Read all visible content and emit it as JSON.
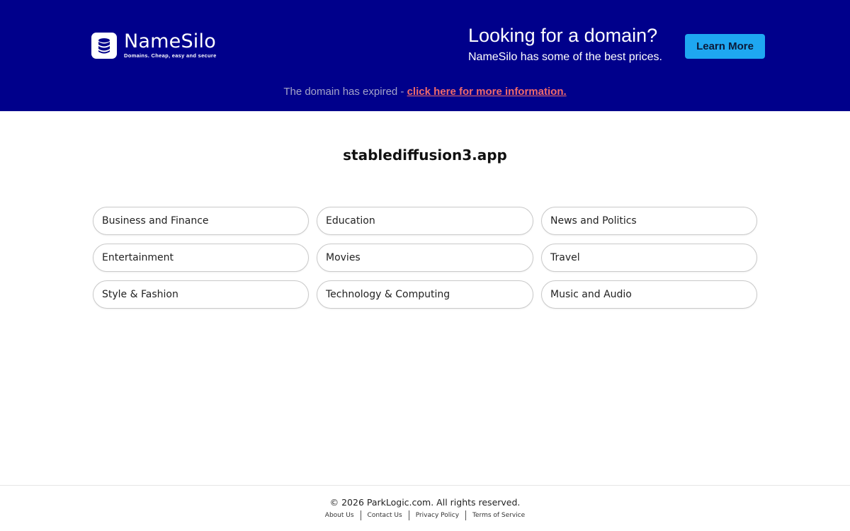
{
  "banner": {
    "logo": {
      "name": "NameSilo",
      "tagline": "Domains. Cheap, easy and secure",
      "icon": "database-icon"
    },
    "promo_title": "Looking for a domain?",
    "promo_subtitle": "NameSilo has some of the best prices.",
    "learn_more_label": "Learn More",
    "expired_text": "The domain has expired - ",
    "expired_link": "click here for more information.",
    "colors": {
      "background": "#00008b",
      "button": "#1ea7f1",
      "link": "#f06a6a"
    }
  },
  "main": {
    "domain": "stablediffusion3.app",
    "categories": [
      "Business and Finance",
      "Education",
      "News and Politics",
      "Entertainment",
      "Movies",
      "Travel",
      "Style & Fashion",
      "Technology & Computing",
      "Music and Audio"
    ]
  },
  "footer": {
    "copyright": "© 2026 ParkLogic.com. All rights reserved.",
    "links": [
      "About Us",
      "Contact Us",
      "Privacy Policy",
      "Terms of Service"
    ]
  }
}
